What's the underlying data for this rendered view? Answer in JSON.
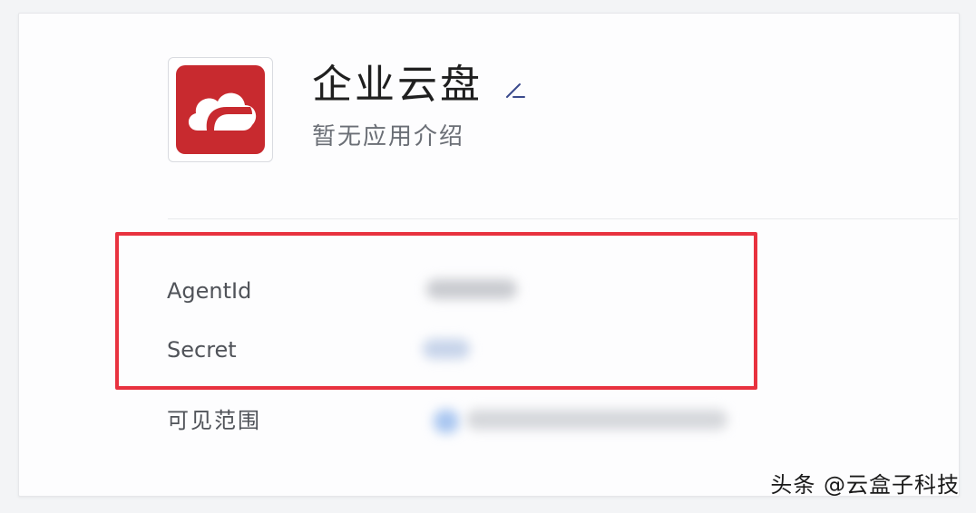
{
  "app": {
    "name": "企业云盘",
    "description": "暂无应用介绍",
    "icon": "cloud-icon",
    "icon_color": "#c82a2f"
  },
  "fields": {
    "agentid_label": "AgentId",
    "secret_label": "Secret",
    "scope_label": "可见范围"
  },
  "highlight_color": "#e8323f",
  "watermark": "头条 @云盒子科技"
}
